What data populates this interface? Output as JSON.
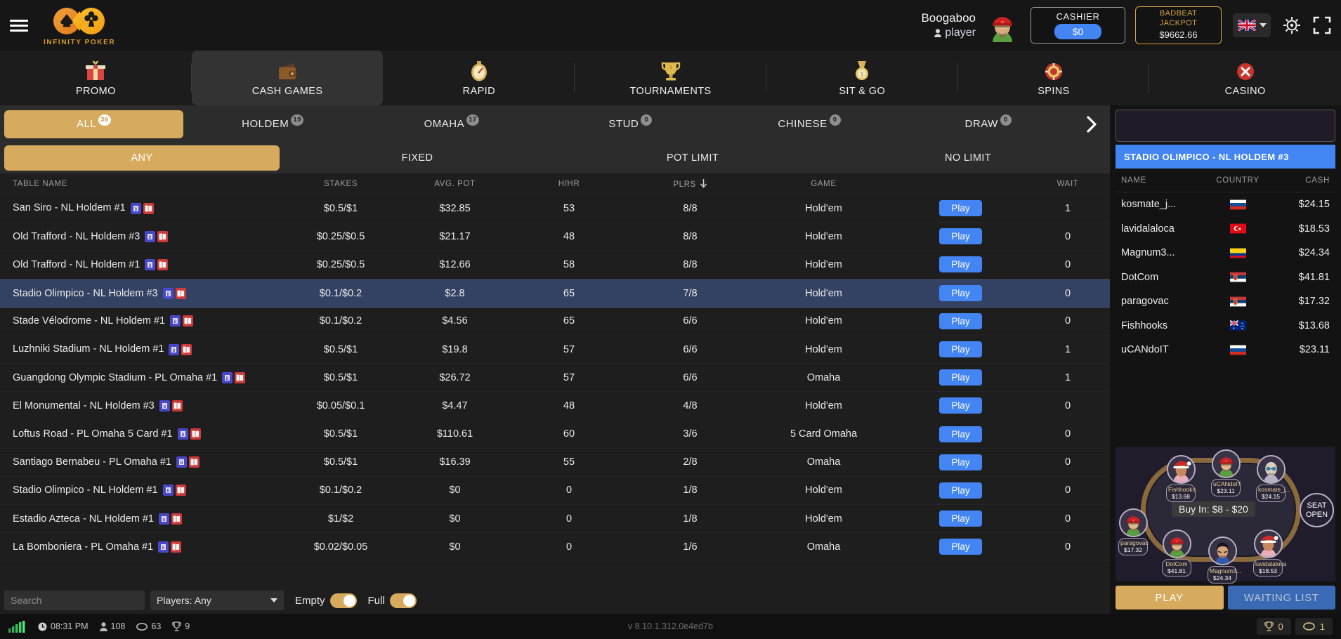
{
  "brand": {
    "name": "INFINITY POKER",
    "logo_icon": "infinity-spade-club-logo"
  },
  "header": {
    "user_name": "Boogaboo",
    "user_role": "player",
    "cashier_label": "CASHIER",
    "cashier_amount": "$0",
    "jackpot_line1": "BADBEAT",
    "jackpot_line2": "JACKPOT",
    "jackpot_amount": "$9662.66",
    "language_flag": "uk-flag-icon",
    "settings_icon": "gear-icon",
    "fullscreen_icon": "fullscreen-icon",
    "menu_icon": "hamburger-menu-icon",
    "accent_gold": "#d7ab5e",
    "accent_blue": "#4485f4"
  },
  "main_nav": [
    {
      "label": "PROMO",
      "icon": "gift-icon",
      "active": false
    },
    {
      "label": "CASH GAMES",
      "icon": "wallet-icon",
      "active": true
    },
    {
      "label": "RAPID",
      "icon": "stopwatch-icon",
      "active": false
    },
    {
      "label": "TOURNAMENTS",
      "icon": "trophy-icon",
      "active": false
    },
    {
      "label": "SIT & GO",
      "icon": "medal-icon",
      "active": false
    },
    {
      "label": "SPINS",
      "icon": "spins-chip-icon",
      "active": false
    },
    {
      "label": "CASINO",
      "icon": "casino-x-icon",
      "active": false
    }
  ],
  "game_tabs": [
    {
      "label": "ALL",
      "count": "36",
      "active": true
    },
    {
      "label": "HOLDEM",
      "count": "19",
      "active": false
    },
    {
      "label": "OMAHA",
      "count": "17",
      "active": false
    },
    {
      "label": "STUD",
      "count": "0",
      "active": false
    },
    {
      "label": "CHINESE",
      "count": "0",
      "active": false
    },
    {
      "label": "DRAW",
      "count": "0",
      "active": false
    }
  ],
  "game_tabs_next_icon": "chevron-right-icon",
  "limit_tabs": [
    {
      "label": "ANY",
      "active": true
    },
    {
      "label": "FIXED",
      "active": false
    },
    {
      "label": "POT LIMIT",
      "active": false
    },
    {
      "label": "NO LIMIT",
      "active": false
    }
  ],
  "table_list": {
    "columns": {
      "name": "TABLE NAME",
      "stakes": "STAKES",
      "avg_pot": "AVG. POT",
      "hhr": "H/HR",
      "plrs": "PLRS",
      "game": "GAME",
      "wait": "WAIT"
    },
    "sort_column": "plrs",
    "sort_icon": "arrow-down-icon",
    "play_label": "Play",
    "rows": [
      {
        "name": "San Siro - NL Holdem #1",
        "stakes": "$0.5/$1",
        "avg_pot": "$32.85",
        "hhr": "53",
        "plrs": "8/8",
        "game": "Hold'em",
        "wait": "1",
        "selected": false
      },
      {
        "name": "Old Trafford - NL Holdem #3",
        "stakes": "$0.25/$0.5",
        "avg_pot": "$21.17",
        "hhr": "48",
        "plrs": "8/8",
        "game": "Hold'em",
        "wait": "0",
        "selected": false
      },
      {
        "name": "Old Trafford - NL Holdem #1",
        "stakes": "$0.25/$0.5",
        "avg_pot": "$12.66",
        "hhr": "58",
        "plrs": "8/8",
        "game": "Hold'em",
        "wait": "0",
        "selected": false
      },
      {
        "name": "Stadio Olimpico - NL Holdem #3",
        "stakes": "$0.1/$0.2",
        "avg_pot": "$2.8",
        "hhr": "65",
        "plrs": "7/8",
        "game": "Hold'em",
        "wait": "0",
        "selected": true
      },
      {
        "name": "Stade Vélodrome - NL Holdem #1",
        "stakes": "$0.1/$0.2",
        "avg_pot": "$4.56",
        "hhr": "65",
        "plrs": "6/6",
        "game": "Hold'em",
        "wait": "0",
        "selected": false
      },
      {
        "name": "Luzhniki Stadium - NL Holdem #1",
        "stakes": "$0.5/$1",
        "avg_pot": "$19.8",
        "hhr": "57",
        "plrs": "6/6",
        "game": "Hold'em",
        "wait": "1",
        "selected": false
      },
      {
        "name": "Guangdong Olympic Stadium - PL Omaha #1",
        "stakes": "$0.5/$1",
        "avg_pot": "$26.72",
        "hhr": "57",
        "plrs": "6/6",
        "game": "Omaha",
        "wait": "1",
        "selected": false
      },
      {
        "name": "El Monumental - NL Holdem #3",
        "stakes": "$0.05/$0.1",
        "avg_pot": "$4.47",
        "hhr": "48",
        "plrs": "4/8",
        "game": "Hold'em",
        "wait": "0",
        "selected": false
      },
      {
        "name": "Loftus Road - PL Omaha 5 Card #1",
        "stakes": "$0.5/$1",
        "avg_pot": "$110.61",
        "hhr": "60",
        "plrs": "3/6",
        "game": "5 Card Omaha",
        "wait": "0",
        "selected": false
      },
      {
        "name": "Santiago Bernabeu - PL Omaha #1",
        "stakes": "$0.5/$1",
        "avg_pot": "$16.39",
        "hhr": "55",
        "plrs": "2/8",
        "game": "Omaha",
        "wait": "0",
        "selected": false
      },
      {
        "name": "Stadio Olimpico - NL Holdem #1",
        "stakes": "$0.1/$0.2",
        "avg_pot": "$0",
        "hhr": "0",
        "plrs": "1/8",
        "game": "Hold'em",
        "wait": "0",
        "selected": false
      },
      {
        "name": "Estadio Azteca - NL Holdem #1",
        "stakes": "$1/$2",
        "avg_pot": "$0",
        "hhr": "0",
        "plrs": "1/8",
        "game": "Hold'em",
        "wait": "0",
        "selected": false
      },
      {
        "name": "La Bomboniera - PL Omaha #1",
        "stakes": "$0.02/$0.05",
        "avg_pot": "$0",
        "hhr": "0",
        "plrs": "1/6",
        "game": "Omaha",
        "wait": "0",
        "selected": false
      }
    ]
  },
  "filters": {
    "search_placeholder": "Search",
    "search_value": "",
    "players_select": "Players: Any",
    "empty_label": "Empty",
    "empty_on": true,
    "full_label": "Full",
    "full_on": true
  },
  "right_panel": {
    "table_title": "STADIO OLIMPICO - NL HOLDEM #3",
    "columns": {
      "name": "NAME",
      "country": "COUNTRY",
      "cash": "CASH"
    },
    "players": [
      {
        "name": "kosmate_j...",
        "country": "si",
        "cash": "$24.15"
      },
      {
        "name": "lavidalaloca",
        "country": "tr",
        "cash": "$18.53"
      },
      {
        "name": "Magnum3...",
        "country": "co",
        "cash": "$24.34"
      },
      {
        "name": "DotCom",
        "country": "rs",
        "cash": "$41.81"
      },
      {
        "name": "paragovac",
        "country": "rs",
        "cash": "$17.32"
      },
      {
        "name": "Fishhooks",
        "country": "au",
        "cash": "$13.68"
      },
      {
        "name": "uCANdoIT",
        "country": "si",
        "cash": "$23.11"
      }
    ],
    "preview": {
      "buy_in": "Buy In: $8 - $20",
      "seat_open": "SEAT OPEN",
      "seats": [
        {
          "name": "Fishhooks",
          "amount": "$13.68",
          "avatar": "santa-girl"
        },
        {
          "name": "uCANdoIT",
          "amount": "$23.11",
          "avatar": "cap-man"
        },
        {
          "name": "kosmate_j...",
          "amount": "$24.15",
          "avatar": "bald-glasses"
        },
        {
          "name": "paragovac",
          "amount": "$17.32",
          "avatar": "cap-man"
        },
        {
          "name": "DotCom",
          "amount": "$41.81",
          "avatar": "cap-man"
        },
        {
          "name": "Magnum3...",
          "amount": "$24.34",
          "avatar": "dark-hair"
        },
        {
          "name": "lavidalaloca",
          "amount": "$18.53",
          "avatar": "santa-girl"
        }
      ]
    },
    "play_label": "PLAY",
    "waiting_list_label": "WAITING LIST"
  },
  "status_bar": {
    "signal_icon": "signal-bars-icon",
    "clock_icon": "clock-icon",
    "time": "08:31 PM",
    "players_icon": "person-icon",
    "players": "108",
    "tables_icon": "table-icon",
    "tables": "63",
    "tournaments_icon": "trophy-icon",
    "tournaments": "9",
    "version": "v 8.10.1.312.0e4ed7b",
    "right_trophy_icon": "trophy-icon",
    "right_trophy_count": "0",
    "right_table_icon": "table-icon",
    "right_table_count": "1"
  }
}
